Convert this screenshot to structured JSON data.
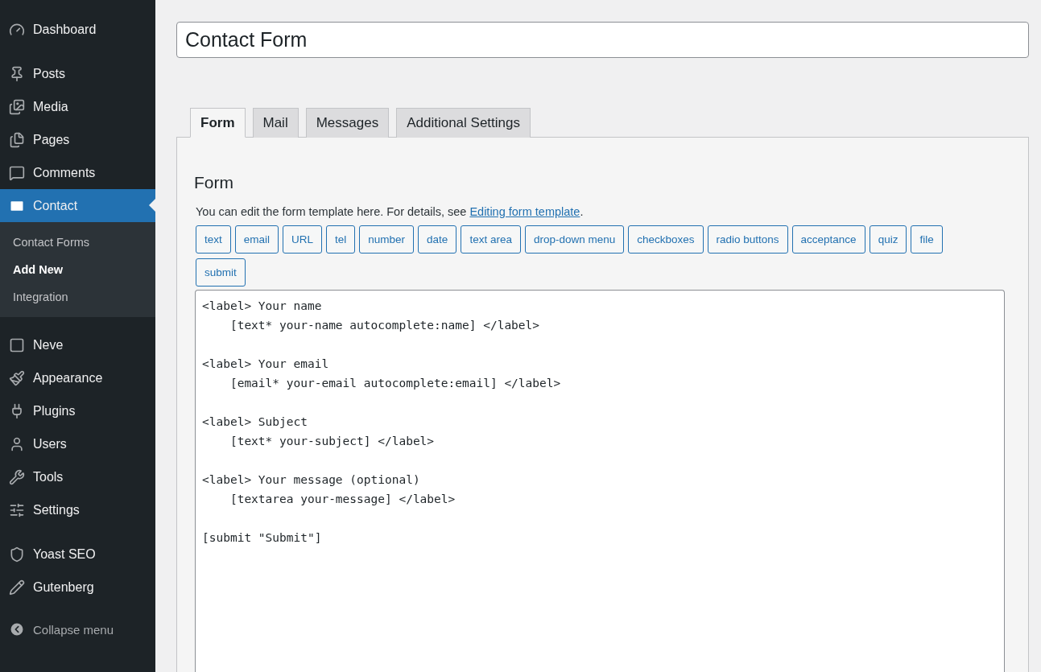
{
  "sidebar": {
    "sections": [
      {
        "items": [
          {
            "label": "Dashboard",
            "selected": false
          }
        ]
      },
      {
        "items": [
          {
            "label": "Posts",
            "selected": false
          },
          {
            "label": "Media",
            "selected": false
          },
          {
            "label": "Pages",
            "selected": false
          },
          {
            "label": "Comments",
            "selected": false
          },
          {
            "label": "Contact",
            "selected": true,
            "submenu": [
              {
                "label": "Contact Forms",
                "selected": false
              },
              {
                "label": "Add New",
                "selected": true
              },
              {
                "label": "Integration",
                "selected": false
              }
            ]
          }
        ]
      },
      {
        "items": [
          {
            "label": "Neve",
            "selected": false
          },
          {
            "label": "Appearance",
            "selected": false
          },
          {
            "label": "Plugins",
            "selected": false
          },
          {
            "label": "Users",
            "selected": false
          },
          {
            "label": "Tools",
            "selected": false
          },
          {
            "label": "Settings",
            "selected": false
          }
        ]
      },
      {
        "items": [
          {
            "label": "Yoast SEO",
            "selected": false
          },
          {
            "label": "Gutenberg",
            "selected": false
          }
        ]
      }
    ],
    "collapse": "Collapse menu"
  },
  "title_field": {
    "value": "Contact Form"
  },
  "tabs": [
    {
      "label": "Form",
      "selected": true
    },
    {
      "label": "Mail",
      "selected": false
    },
    {
      "label": "Messages",
      "selected": false
    },
    {
      "label": "Additional Settings",
      "selected": false
    }
  ],
  "panel": {
    "heading": "Form",
    "description": {
      "before": "You can edit the form template here. For details, see ",
      "link": "Editing form template",
      "after": "."
    },
    "tag_buttons": [
      "text",
      "email",
      "URL",
      "tel",
      "number",
      "date",
      "text area",
      "drop-down menu",
      "checkboxes",
      "radio buttons",
      "acceptance",
      "quiz",
      "file",
      "submit"
    ],
    "template": "<label> Your name\n    [text* your-name autocomplete:name] </label>\n\n<label> Your email\n    [email* your-email autocomplete:email] </label>\n\n<label> Subject\n    [text* your-subject] </label>\n\n<label> Your message (optional)\n    [textarea your-message] </label>\n\n[submit \"Submit\"]"
  }
}
